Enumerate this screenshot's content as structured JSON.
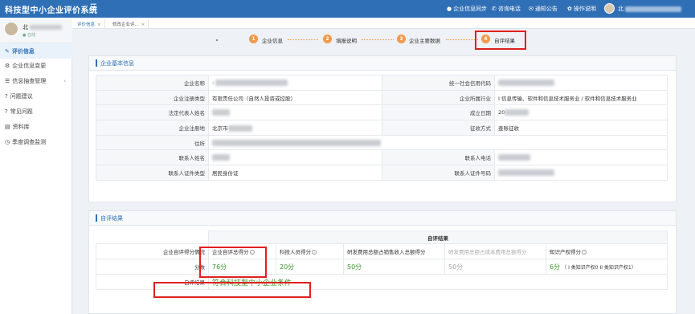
{
  "header": {
    "app_title": "科技型中小企业评价系统",
    "items": [
      {
        "label": "企业信息同步",
        "icon": "person-icon"
      },
      {
        "label": "咨询电话",
        "icon": "phone-icon"
      },
      {
        "label": "通知公告",
        "icon": "mail-icon"
      },
      {
        "label": "操作说明",
        "icon": "gear-icon"
      }
    ],
    "user_prefix": "北"
  },
  "sidebar": {
    "user_name": "北",
    "user_status": "在线",
    "items": [
      {
        "label": "评价信息",
        "active": true
      },
      {
        "label": "企业信息变更"
      },
      {
        "label": "信息抽查管理",
        "has_arrow": true
      },
      {
        "label": "问题建议"
      },
      {
        "label": "常见问题"
      },
      {
        "label": "资料库"
      },
      {
        "label": "季度调查监测"
      }
    ]
  },
  "tabs": [
    {
      "label": "评价信息"
    },
    {
      "label": "修改企业评..."
    }
  ],
  "steps": [
    {
      "num": "1",
      "label": "企业信息"
    },
    {
      "num": "2",
      "label": "填报说明"
    },
    {
      "num": "3",
      "label": "企业主要数据"
    },
    {
      "num": "4",
      "label": "自评结果"
    }
  ],
  "basic_info": {
    "title": "企业基本信息",
    "fields": {
      "company_name": "企业名称",
      "credit_code": "统一社会信用代码",
      "reg_type": "企业注册类型",
      "reg_type_value": "有限责任公司（自然人投资或控股）",
      "industry": "企业所属行业",
      "industry_value": "I 信息传输、软件和信息技术服务业 / 软件和信息技术服务业",
      "legal_rep": "法定代表人姓名",
      "founded": "成立日期",
      "founded_value": "20",
      "reg_place": "企业注册地",
      "reg_place_value": "北京市",
      "tax_method": "征收方式",
      "tax_method_value": "查账征收",
      "address": "住所",
      "contact_name": "联系人姓名",
      "contact_phone": "联系人电话",
      "id_type": "联系人证件类型",
      "id_type_value": "居民身份证",
      "id_number": "联系人证件号码"
    }
  },
  "result": {
    "title": "自评结果",
    "table_title": "自评结果",
    "row_label_scores": "企业自评得分情况",
    "row_label_points": "分数",
    "row_label_result": "自评结果",
    "columns": [
      {
        "label": "企业自评总得分",
        "value": "76分",
        "has_info": true
      },
      {
        "label": "科技人员得分",
        "value": "20分",
        "has_info": true
      },
      {
        "label": "研发费用总额占销售收入总额得分",
        "value": "50分",
        "has_info": false
      },
      {
        "label": "研发费用总额占成本费用总额得分",
        "value": "50分",
        "has_info": false,
        "muted": true
      },
      {
        "label": "知识产权得分",
        "value": "6分",
        "has_info": true,
        "note": "（ I 类知识产权0 II 类知识产权1）"
      }
    ],
    "conclusion": "符合科技型中小企业条件"
  }
}
